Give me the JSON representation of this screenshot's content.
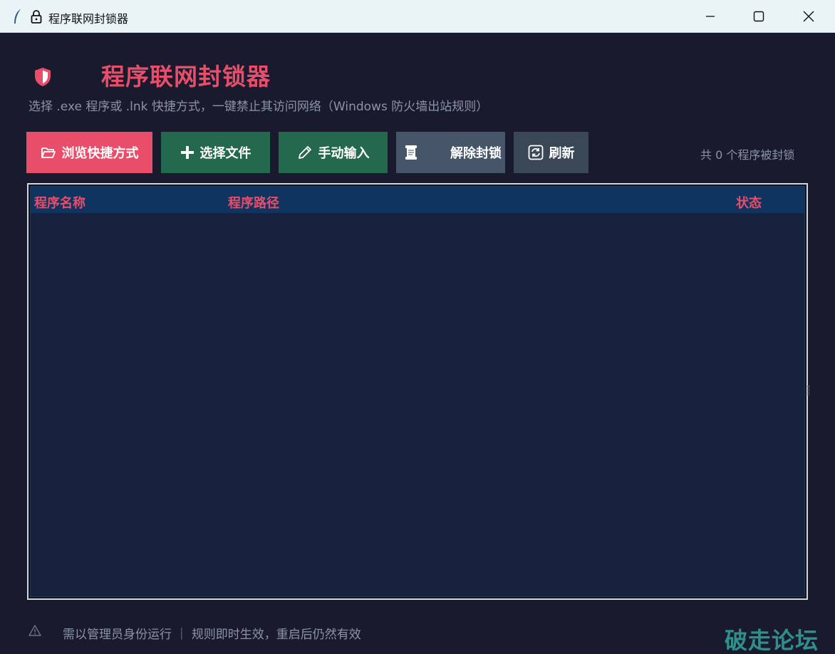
{
  "window": {
    "title": "程序联网封锁器"
  },
  "header": {
    "title": "程序联网封锁器",
    "subtitle": "选择 .exe 程序或 .lnk 快捷方式，一键禁止其访问网络（Windows 防火墙出站规则）",
    "icon": "shield-icon"
  },
  "toolbar": {
    "browse_label": "浏览快捷方式",
    "select_label": "选择文件",
    "manual_label": "手动输入",
    "unblock_label": "解除封锁",
    "refresh_label": "刷新",
    "count_text": "共 0 个程序被封锁"
  },
  "table": {
    "columns": [
      "程序名称",
      "程序路径",
      "状态"
    ],
    "rows": []
  },
  "footer": {
    "warning_icon": "warning-icon",
    "text": "需以管理员身份运行 ｜ 规则即时生效，重启后仍然有效"
  },
  "watermark": "破走论坛",
  "colors": {
    "accent": "#e84d6a",
    "green_button": "#24684d",
    "gray_button": "#475569",
    "refresh_button": "#3a4756",
    "background": "#1a1a2e",
    "table_header": "#0f3460",
    "table_body": "#16213e"
  }
}
